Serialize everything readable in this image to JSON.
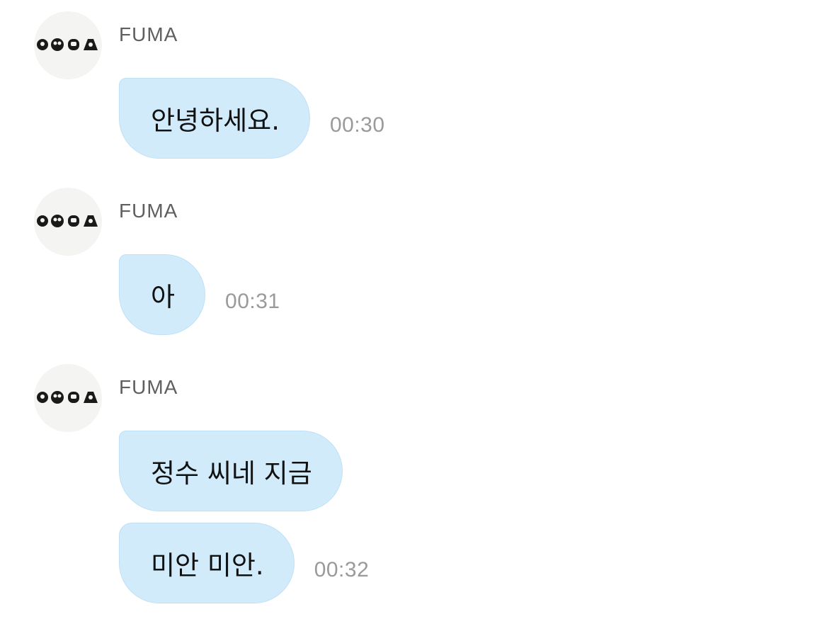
{
  "conversation": {
    "messages": [
      {
        "sender": "FUMA",
        "bubbles": [
          "안녕하세요."
        ],
        "time": "00:30"
      },
      {
        "sender": "FUMA",
        "bubbles": [
          "아"
        ],
        "time": "00:31"
      },
      {
        "sender": "FUMA",
        "bubbles": [
          "정수 씨네 지금",
          "미안 미안."
        ],
        "time": "00:32"
      }
    ]
  },
  "colors": {
    "bubble_bg": "#d2ebfb",
    "bubble_border": "#bfe0f6",
    "sender_text": "#5f5f5f",
    "time_text": "#9a9a9a",
    "message_text": "#111111"
  }
}
